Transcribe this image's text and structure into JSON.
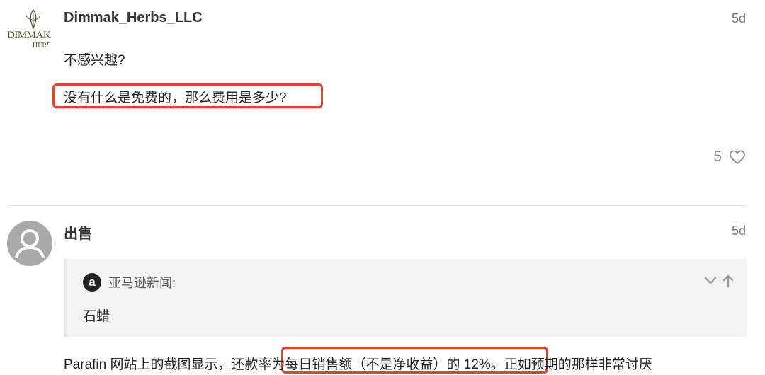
{
  "posts": [
    {
      "username": "Dimmak_Herbs_LLC",
      "date": "5d",
      "avatar_text": "DIMMAK",
      "avatar_sub": "HERB",
      "paragraphs": [
        "不感兴趣?",
        "没有什么是免费的，那么费用是多少?"
      ],
      "likes": "5"
    },
    {
      "username": "出售",
      "date": "5d",
      "quote": {
        "badge": "a",
        "author": "亚马逊新闻:",
        "body": "石蜡"
      },
      "paragraph": "Parafin 网站上的截图显示，还款率为每日销售额（不是净收益）的 12%。正如预期的那样非常讨厌"
    }
  ],
  "colors": {
    "highlight": "#e5412d",
    "quote_bg": "#f3f3f3",
    "muted": "#777777"
  },
  "icons": [
    "heart-icon",
    "chevron-down-icon",
    "arrow-up-icon",
    "user-avatar-icon"
  ]
}
